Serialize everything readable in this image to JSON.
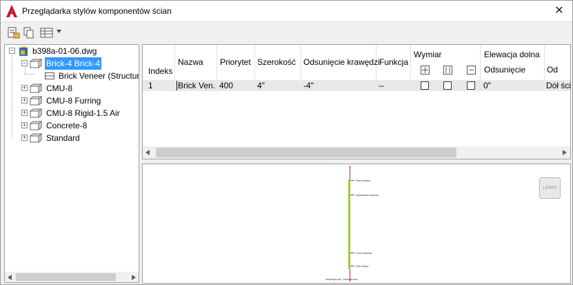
{
  "window": {
    "title": "Przeglądarka stylów komponentów ścian",
    "close_glyph": "✕"
  },
  "toolbar": {
    "icons": [
      "style-properties-icon",
      "copy-icon",
      "table-view-icon",
      "dropdown-arrow-icon"
    ]
  },
  "tree": {
    "root": {
      "label": "b398a-01-06.dwg",
      "expander": "−"
    },
    "items": [
      {
        "label": "Brick-4 Brick-4",
        "expander": "−",
        "selected": true
      },
      {
        "label": "Brick Veneer (Structur",
        "child": true
      },
      {
        "label": "CMU-8",
        "expander": "+"
      },
      {
        "label": "CMU-8 Furring",
        "expander": "+"
      },
      {
        "label": "CMU-8 Rigid-1.5 Air",
        "expander": "+"
      },
      {
        "label": "Concrete-8",
        "expander": "+"
      },
      {
        "label": "Standard",
        "expander": "+"
      }
    ]
  },
  "grid": {
    "headers": {
      "index": "Indeks",
      "name": "Nazwa",
      "priority": "Priorytet",
      "width": "Szerokość",
      "edge_offset": "Odsunięcie krawędzi",
      "function": "Funkcja",
      "dimension": "Wymiar",
      "bottom_elevation": "Elewacja dolna",
      "offset": "Odsunięcie",
      "from": "Od"
    },
    "rows": [
      {
        "index": "1",
        "name": "Brick Ven...",
        "priority": "400",
        "width": "4\"",
        "edge_offset": "-4\"",
        "function": "--",
        "offset": "0\"",
        "from": "Dół ści"
      }
    ]
  },
  "preview": {
    "lewo_label": "LEWO",
    "labels": [
      "Góra ściany",
      "Wysokość bazowa",
      "Linia bazowa",
      "Dół ściany",
      "Wewnętrzna | Zewnętrzna"
    ]
  },
  "colors": {
    "selection": "#3399ff",
    "app_red": "#c8102e",
    "wall_green": "#9acd32",
    "wall_red": "#b22222"
  }
}
